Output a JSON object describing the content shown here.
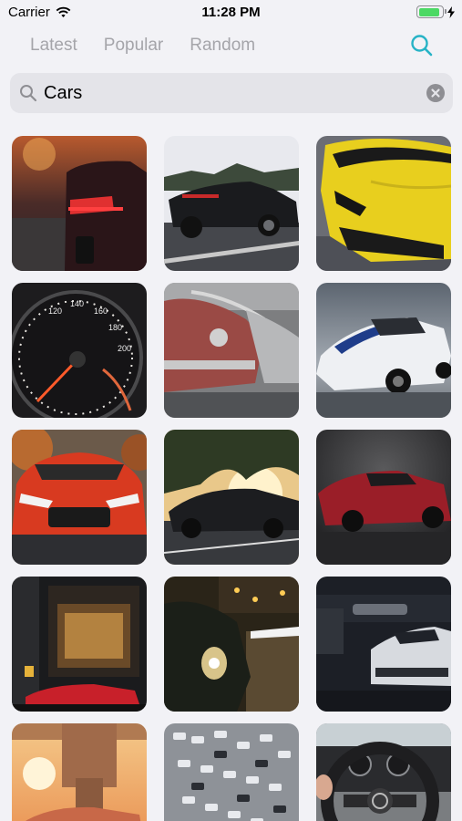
{
  "status_bar": {
    "carrier": "Carrier",
    "time": "11:28 PM",
    "battery_level": 0.9,
    "charging": true
  },
  "tabs": [
    {
      "label": "Latest"
    },
    {
      "label": "Popular"
    },
    {
      "label": "Random"
    }
  ],
  "search": {
    "value": "Cars",
    "icon": "search-icon",
    "clear_icon": "clear-icon"
  },
  "accent_color": "#27b3c6",
  "wallpapers": [
    {
      "subject": "red sports car taillights on city street"
    },
    {
      "subject": "black sedan on road"
    },
    {
      "subject": "yellow supercar front"
    },
    {
      "subject": "speedometer gauge"
    },
    {
      "subject": "row of vintage cars"
    },
    {
      "subject": "white mustang with blue stripes"
    },
    {
      "subject": "red nissan gt-r front"
    },
    {
      "subject": "black coupe under trees at sunset"
    },
    {
      "subject": "red audi r8 in dark"
    },
    {
      "subject": "red car in front of building at night"
    },
    {
      "subject": "black porsche on night street"
    },
    {
      "subject": "white camaro in parking garage"
    },
    {
      "subject": "car under concrete bridge at sunset"
    },
    {
      "subject": "aerial view of parking lot"
    },
    {
      "subject": "steering wheel interior"
    }
  ]
}
